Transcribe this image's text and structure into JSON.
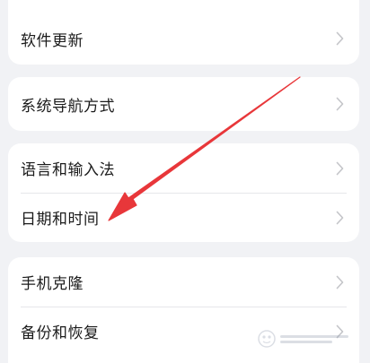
{
  "groups": [
    {
      "items": [
        {
          "label": "软件更新"
        }
      ]
    },
    {
      "items": [
        {
          "label": "系统导航方式"
        }
      ]
    },
    {
      "items": [
        {
          "label": "语言和输入法"
        },
        {
          "label": "日期和时间"
        }
      ]
    },
    {
      "items": [
        {
          "label": "手机克隆"
        },
        {
          "label": "备份和恢复"
        }
      ]
    }
  ],
  "annotation": {
    "arrow_color": "#e8373a"
  }
}
